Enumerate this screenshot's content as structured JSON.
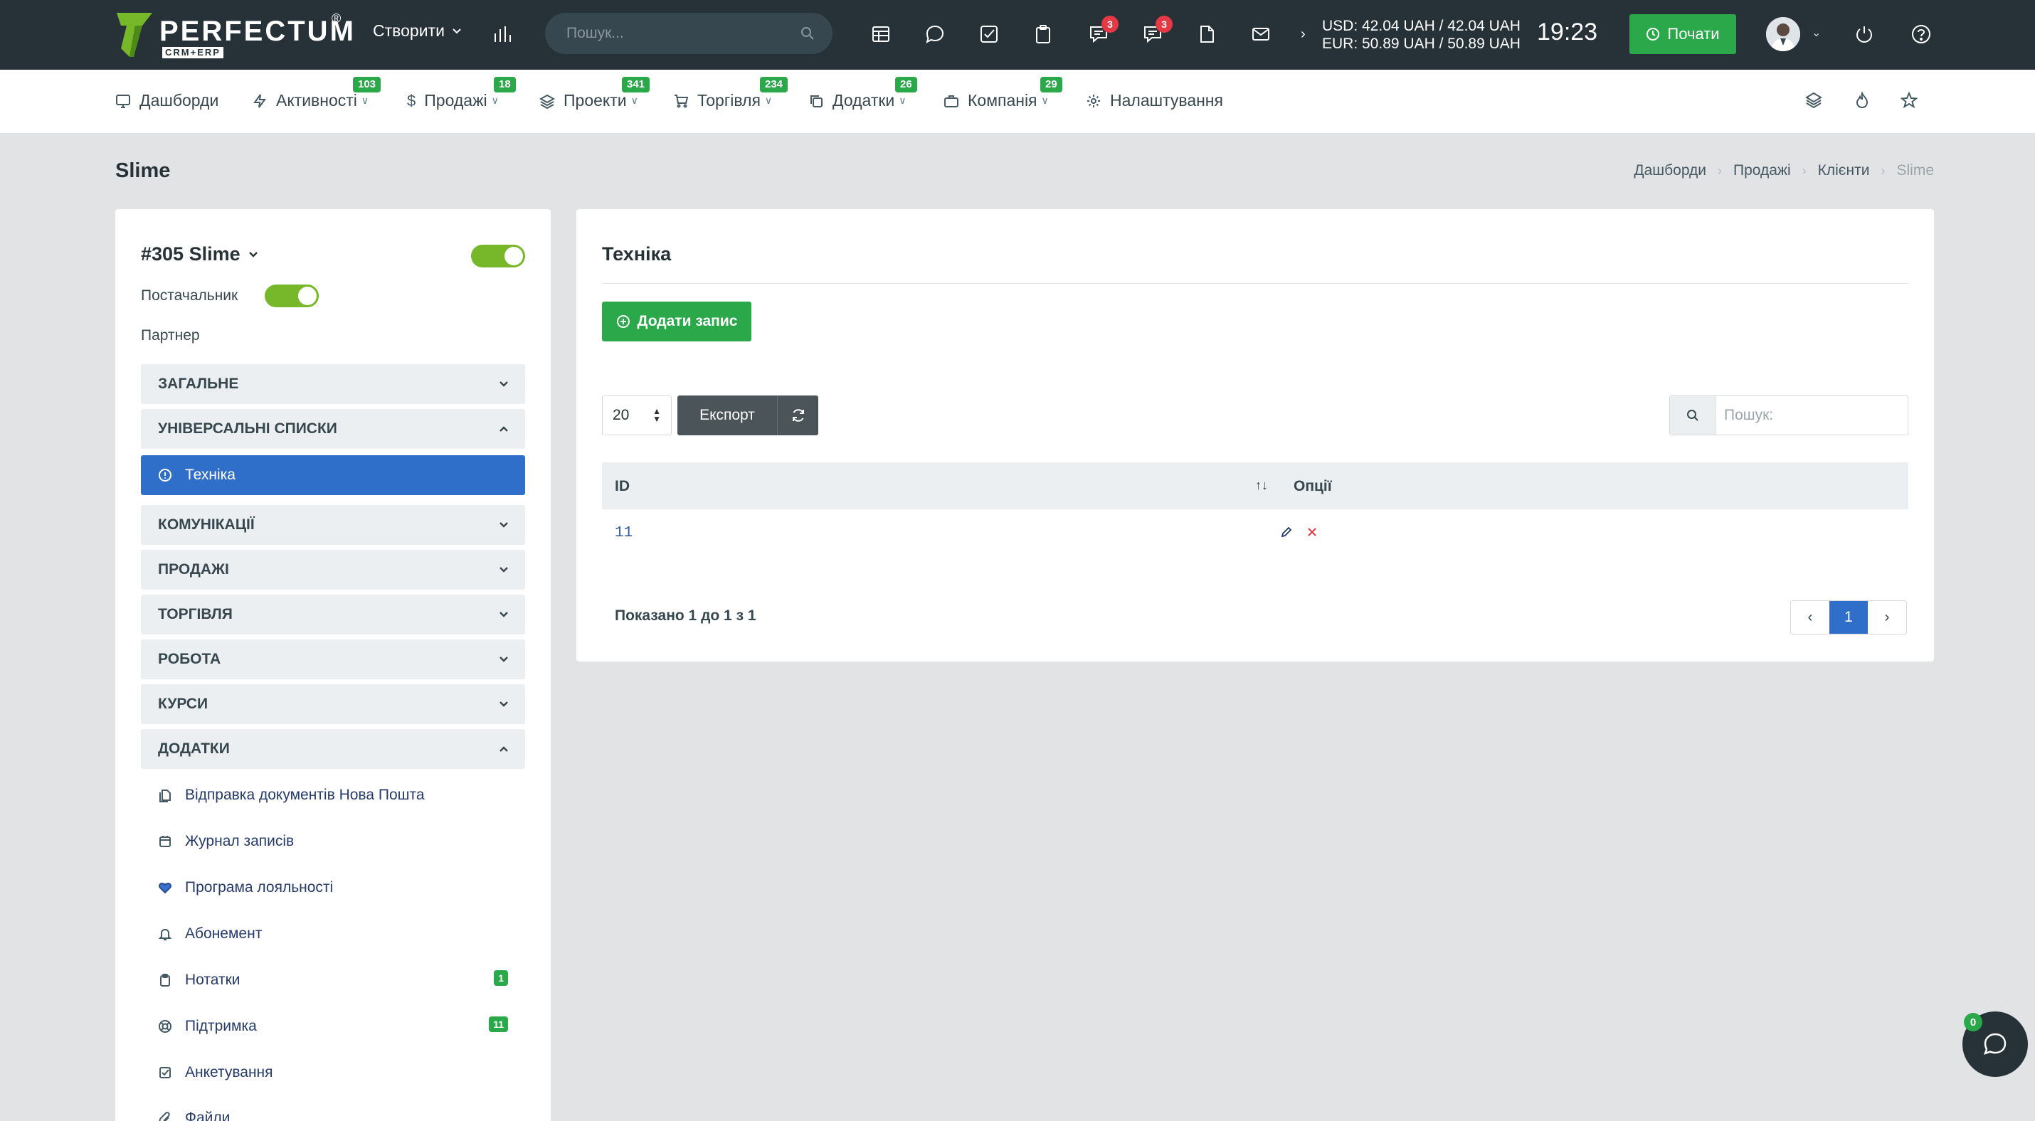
{
  "topbar": {
    "logo_text": "PERFECTUM",
    "logo_reg": "®",
    "logo_sub": "CRM+ERP",
    "create_label": "Створити",
    "search_placeholder": "Пошук...",
    "badges": {
      "chat_messages": "3",
      "comments": "3"
    },
    "currency": {
      "usd": "USD: 42.04 UAH / 42.04 UAH",
      "eur": "EUR: 50.89 UAH / 50.89 UAH"
    },
    "time": "19:23",
    "start_label": "Почати",
    "icons": [
      "chart-bars-icon",
      "search-icon",
      "calendar-icon",
      "chat-bubble-icon",
      "task-check-icon",
      "clipboard-icon",
      "comments-icon",
      "message-lines-icon",
      "document-icon",
      "mail-icon",
      "power-icon",
      "help-icon"
    ]
  },
  "nav": {
    "items": [
      {
        "label": "Дашборди",
        "badge": ""
      },
      {
        "label": "Активності",
        "badge": "103"
      },
      {
        "label": "Продажі",
        "badge": "18"
      },
      {
        "label": "Проекти",
        "badge": "341"
      },
      {
        "label": "Торгівля",
        "badge": "234"
      },
      {
        "label": "Додатки",
        "badge": "26"
      },
      {
        "label": "Компанія",
        "badge": "29"
      },
      {
        "label": "Налаштування",
        "badge": ""
      }
    ]
  },
  "page": {
    "title": "Slime",
    "breadcrumb": [
      "Дашборди",
      "Продажі",
      "Клієнти",
      "Slime"
    ]
  },
  "client": {
    "name": "#305 Slime",
    "supplier_label": "Постачальник",
    "partner_label": "Партнер",
    "sections": {
      "general": "ЗАГАЛЬНЕ",
      "universal_lists": "УНІВЕРСАЛЬНІ СПИСКИ",
      "active_item": "Техніка",
      "communications": "КОМУНІКАЦІЇ",
      "sales": "ПРОДАЖІ",
      "trade": "ТОРГІВЛЯ",
      "work": "РОБОТА",
      "courses": "КУРСИ",
      "addons": "ДОДАТКИ"
    },
    "addons": [
      {
        "label": "Відправка документів Нова Пошта",
        "badge": ""
      },
      {
        "label": "Журнал записів",
        "badge": ""
      },
      {
        "label": "Програма лояльності",
        "badge": ""
      },
      {
        "label": "Абонемент",
        "badge": ""
      },
      {
        "label": "Нотатки",
        "badge": "1"
      },
      {
        "label": "Підтримка",
        "badge": "11"
      },
      {
        "label": "Анкетування",
        "badge": ""
      },
      {
        "label": "Файли",
        "badge": ""
      }
    ]
  },
  "table_card": {
    "title": "Техніка",
    "add_label": "Додати запис",
    "page_size": "20",
    "export_label": "Експорт",
    "search_placeholder": "Пошук:",
    "columns": [
      "ID",
      "Опції"
    ],
    "rows": [
      {
        "id": "11"
      }
    ],
    "showing": "Показано 1 до 1 з 1",
    "current_page": "1"
  },
  "chat_widget": {
    "badge": "0"
  },
  "colors": {
    "topbar": "#263238",
    "accent_green": "#2aa84a",
    "toggle_green": "#76b82a",
    "active_blue": "#2f6fca",
    "danger": "#e53945"
  }
}
